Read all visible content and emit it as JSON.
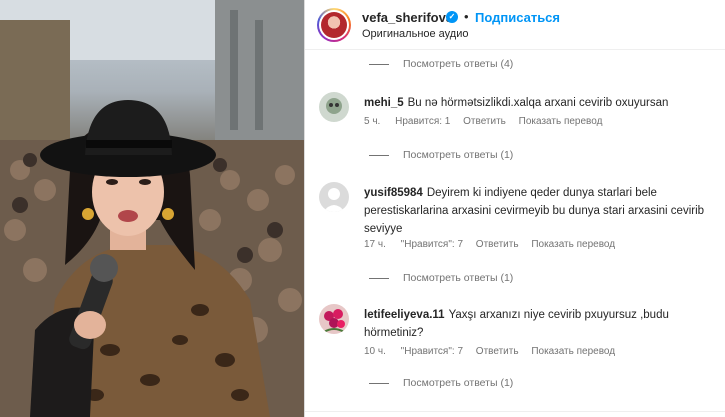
{
  "post": {
    "username": "vefa_sherifova",
    "verified_icon": "verified-badge-icon",
    "separator": "•",
    "follow_label": "Подписаться",
    "audio_label": "Оригинальное аудио",
    "accent_color": "#0095f6"
  },
  "top_replies": {
    "label": "Посмотреть ответы (4)"
  },
  "comments": [
    {
      "username": "mehi_5",
      "text": "Bu nə hörmətsizlikdi.xalqa arxani cevirib oxuyursan",
      "time": "5 ч.",
      "likes": "Нравится: 1",
      "reply": "Ответить",
      "translate": "Показать перевод",
      "replies": "Посмотреть ответы (1)"
    },
    {
      "username": "yusif85984",
      "text": "Deyirem ki indiyene qeder dunya starlari bele perestiskarlarina arxasini cevirmeyib bu dunya stari arxasini cevirib seviyye",
      "time": "17 ч.",
      "likes": "\"Нравится\": 7",
      "reply": "Ответить",
      "translate": "Показать перевод",
      "replies": "Посмотреть ответы (1)"
    },
    {
      "username": "letifeeliyeva.11",
      "text": "Yaxşı arxanızı niye cevirib pxuyursuz ,budu hörmetiniz?",
      "time": "10 ч.",
      "likes": "\"Нравится\": 7",
      "reply": "Ответить",
      "translate": "Показать перевод",
      "replies": "Посмотреть ответы (1)"
    }
  ]
}
